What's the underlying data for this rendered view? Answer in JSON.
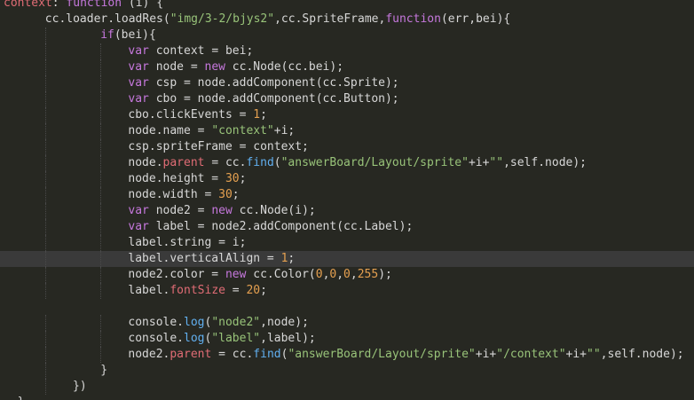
{
  "editor": {
    "language": "javascript",
    "lines": [
      {
        "indent": 0,
        "tokens": [
          [
            "p",
            "context"
          ],
          [
            "t",
            ": "
          ],
          [
            "k",
            "function"
          ],
          [
            "t",
            " (i) {"
          ]
        ]
      },
      {
        "indent": 6,
        "tokens": [
          [
            "t",
            "cc.loader.loadRes("
          ],
          [
            "s",
            "\"img/3-2/bjys2\""
          ],
          [
            "t",
            ",cc.SpriteFrame,"
          ],
          [
            "k",
            "function"
          ],
          [
            "t",
            "(err,bei){"
          ]
        ]
      },
      {
        "indent": 14,
        "tokens": [
          [
            "k",
            "if"
          ],
          [
            "t",
            "(bei){"
          ]
        ]
      },
      {
        "indent": 18,
        "tokens": [
          [
            "k",
            "var"
          ],
          [
            "t",
            " context = bei;"
          ]
        ]
      },
      {
        "indent": 18,
        "tokens": [
          [
            "k",
            "var"
          ],
          [
            "t",
            " node = "
          ],
          [
            "k",
            "new"
          ],
          [
            "t",
            " cc.Node(cc.bei);"
          ]
        ]
      },
      {
        "indent": 18,
        "tokens": [
          [
            "k",
            "var"
          ],
          [
            "t",
            " csp = node.addComponent(cc.Sprite);"
          ]
        ]
      },
      {
        "indent": 18,
        "tokens": [
          [
            "k",
            "var"
          ],
          [
            "t",
            " cbo = node.addComponent(cc.Button);"
          ]
        ]
      },
      {
        "indent": 18,
        "tokens": [
          [
            "t",
            "cbo.clickEvents = "
          ],
          [
            "n",
            "1"
          ],
          [
            "t",
            ";"
          ]
        ]
      },
      {
        "indent": 18,
        "tokens": [
          [
            "t",
            "node.name = "
          ],
          [
            "s",
            "\"context\""
          ],
          [
            "t",
            "+i;"
          ]
        ]
      },
      {
        "indent": 18,
        "tokens": [
          [
            "t",
            "csp.spriteFrame = context;"
          ]
        ]
      },
      {
        "indent": 18,
        "tokens": [
          [
            "t",
            "node."
          ],
          [
            "p",
            "parent"
          ],
          [
            "t",
            " = cc."
          ],
          [
            "f",
            "find"
          ],
          [
            "t",
            "("
          ],
          [
            "s",
            "\"answerBoard/Layout/sprite\""
          ],
          [
            "t",
            "+i+"
          ],
          [
            "s",
            "\"\""
          ],
          [
            "t",
            ",self.node);"
          ]
        ]
      },
      {
        "indent": 18,
        "tokens": [
          [
            "t",
            "node.height = "
          ],
          [
            "n",
            "30"
          ],
          [
            "t",
            ";"
          ]
        ]
      },
      {
        "indent": 18,
        "tokens": [
          [
            "t",
            "node.width = "
          ],
          [
            "n",
            "30"
          ],
          [
            "t",
            ";"
          ]
        ]
      },
      {
        "indent": 18,
        "tokens": [
          [
            "k",
            "var"
          ],
          [
            "t",
            " node2 = "
          ],
          [
            "k",
            "new"
          ],
          [
            "t",
            " cc.Node(i);"
          ]
        ]
      },
      {
        "indent": 18,
        "tokens": [
          [
            "k",
            "var"
          ],
          [
            "t",
            " label = node2.addComponent(cc.Label);"
          ]
        ]
      },
      {
        "indent": 18,
        "tokens": [
          [
            "t",
            "label.string = i;"
          ]
        ]
      },
      {
        "indent": 18,
        "current": true,
        "tokens": [
          [
            "t",
            "label.verticalAlign = "
          ],
          [
            "n",
            "1"
          ],
          [
            "t",
            ";"
          ]
        ]
      },
      {
        "indent": 18,
        "tokens": [
          [
            "t",
            "node2.color = "
          ],
          [
            "k",
            "new"
          ],
          [
            "t",
            " cc.Color("
          ],
          [
            "n",
            "0"
          ],
          [
            "t",
            ","
          ],
          [
            "n",
            "0"
          ],
          [
            "t",
            ","
          ],
          [
            "n",
            "0"
          ],
          [
            "t",
            ","
          ],
          [
            "n",
            "255"
          ],
          [
            "t",
            ");"
          ]
        ]
      },
      {
        "indent": 18,
        "tokens": [
          [
            "t",
            "label."
          ],
          [
            "p",
            "fontSize"
          ],
          [
            "t",
            " = "
          ],
          [
            "n",
            "20"
          ],
          [
            "t",
            ";"
          ]
        ]
      },
      {
        "indent": 0,
        "tokens": []
      },
      {
        "indent": 18,
        "tokens": [
          [
            "t",
            "console."
          ],
          [
            "f",
            "log"
          ],
          [
            "t",
            "("
          ],
          [
            "s",
            "\"node2\""
          ],
          [
            "t",
            ",node);"
          ]
        ]
      },
      {
        "indent": 18,
        "tokens": [
          [
            "t",
            "console."
          ],
          [
            "f",
            "log"
          ],
          [
            "t",
            "("
          ],
          [
            "s",
            "\"label\""
          ],
          [
            "t",
            ",label);"
          ]
        ]
      },
      {
        "indent": 18,
        "tokens": [
          [
            "t",
            "node2."
          ],
          [
            "p",
            "parent"
          ],
          [
            "t",
            " = cc."
          ],
          [
            "f",
            "find"
          ],
          [
            "t",
            "("
          ],
          [
            "s",
            "\"answerBoard/Layout/sprite\""
          ],
          [
            "t",
            "+i+"
          ],
          [
            "s",
            "\"/context\""
          ],
          [
            "t",
            "+i+"
          ],
          [
            "s",
            "\"\""
          ],
          [
            "t",
            ",self.node);"
          ]
        ]
      },
      {
        "indent": 14,
        "tokens": [
          [
            "t",
            "}"
          ]
        ]
      },
      {
        "indent": 10,
        "tokens": [
          [
            "t",
            "})"
          ]
        ]
      },
      {
        "indent": 2,
        "tokens": [
          [
            "t",
            "}"
          ]
        ]
      }
    ]
  },
  "colors": {
    "background": "#272822",
    "current_line": "#3a3a3a",
    "keyword": "#c678dd",
    "string": "#98c379",
    "number": "#e5a050",
    "property": "#e06c75",
    "builtin": "#61afef",
    "text": "#d7d7d7"
  }
}
